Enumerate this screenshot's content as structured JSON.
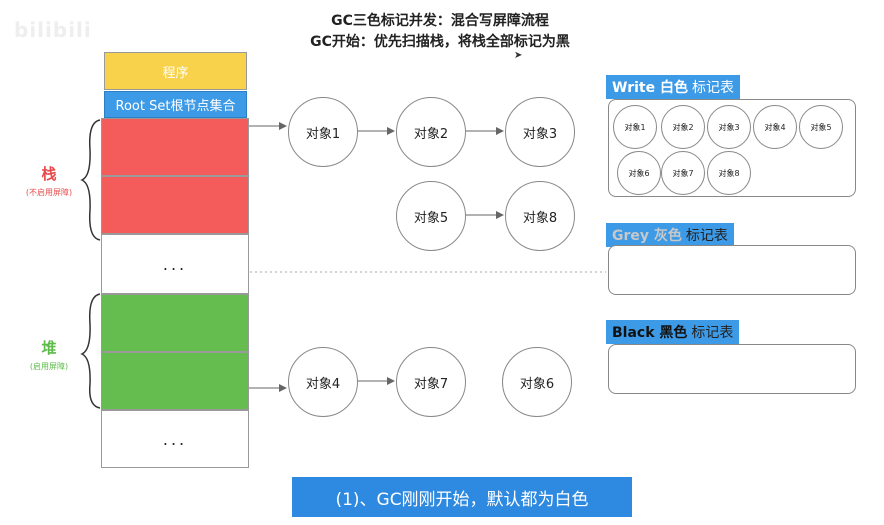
{
  "header": {
    "title_line1": "GC三色标记并发：混合写屏障流程",
    "title_line2": "GC开始：优先扫描栈，将栈全部标记为黑"
  },
  "watermark": "bilibili",
  "left_column": {
    "program": "程序",
    "root_set": "Root Set根节点集合",
    "stack_dots": "...",
    "heap_dots": "..."
  },
  "stack": {
    "label": "栈",
    "sub": "(不启用屏障)"
  },
  "heap": {
    "label": "堆",
    "sub": "(启用屏障)"
  },
  "nodes": {
    "n1": "对象1",
    "n2": "对象2",
    "n3": "对象3",
    "n5": "对象5",
    "n8": "对象8",
    "n4": "对象4",
    "n7": "对象7",
    "n6": "对象6"
  },
  "tables": {
    "white": {
      "highlight": "Write 白色",
      "rest": "标记表",
      "items": [
        "对象1",
        "对象2",
        "对象3",
        "对象4",
        "对象5",
        "对象6",
        "对象7",
        "对象8"
      ]
    },
    "grey": {
      "highlight": "Grey 灰色",
      "rest": "标记表"
    },
    "black": {
      "highlight": "Black 黑色",
      "rest": "标记表"
    }
  },
  "colors": {
    "program": "#f7d24a",
    "root_set": "#3d9ae6",
    "stack": "#f45b5b",
    "heap": "#66bd4f",
    "caption_bg": "#2e89e0"
  },
  "caption": "(1)、GC刚刚开始，默认都为白色"
}
